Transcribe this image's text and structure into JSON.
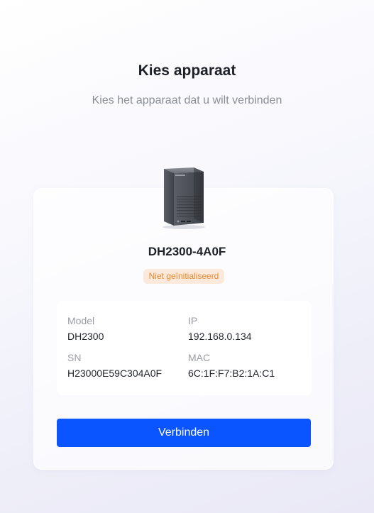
{
  "header": {
    "title": "Kies apparaat",
    "subtitle": "Kies het apparaat dat u wilt verbinden"
  },
  "device": {
    "name": "DH2300-4A0F",
    "status": "Niet geïnitialiseerd",
    "fields": {
      "model": {
        "label": "Model",
        "value": "DH2300"
      },
      "ip": {
        "label": "IP",
        "value": "192.168.0.134"
      },
      "sn": {
        "label": "SN",
        "value": "H23000E59C304A0F"
      },
      "mac": {
        "label": "MAC",
        "value": "6C:1F:F7:B2:1A:C1"
      }
    }
  },
  "actions": {
    "connect_label": "Verbinden"
  },
  "colors": {
    "accent": "#0a55ff",
    "status_text": "#e8892f",
    "status_bg": "#fbe9dc"
  },
  "icons": {
    "device": "nas-device-icon"
  }
}
